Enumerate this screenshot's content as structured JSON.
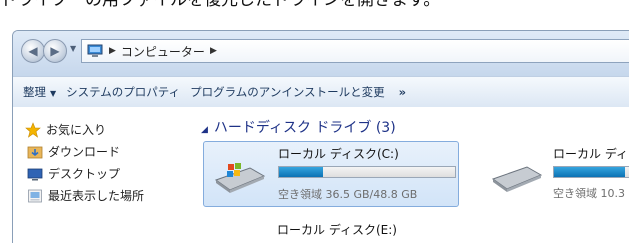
{
  "caption": "ドライブーの用ファイルを復元したドラインを開きます。",
  "titlebar": {
    "breadcrumb": [
      "コンピューター"
    ]
  },
  "toolbar": {
    "items": [
      "整理",
      "システムのプロパティ",
      "プログラムのアンインストールと変更"
    ],
    "more": "»"
  },
  "navigation": {
    "items": [
      {
        "label": "お気に入り",
        "icon": "star-icon"
      },
      {
        "label": "ダウンロード",
        "icon": "download-folder-icon"
      },
      {
        "label": "デスクトップ",
        "icon": "desktop-icon"
      },
      {
        "label": "最近表示した場所",
        "icon": "recent-places-icon"
      }
    ]
  },
  "content": {
    "group_header": "ハードディスク ドライブ (3)",
    "drives": [
      {
        "name": "ローカル ディスク(C:)",
        "free": "空き領域 36.5 GB/48.8 GB",
        "used_fraction": 0.25,
        "selected": true
      },
      {
        "name": "ローカル ディス",
        "free": "空き領域 10.3",
        "used_fraction": 0.9,
        "selected": false
      },
      {
        "name": "ローカル ディスク(E:)",
        "free": "",
        "used_fraction": null,
        "selected": false
      }
    ]
  },
  "colors": {
    "selection": "#d2e4f8",
    "bar_fill": "#1a86c9",
    "link_blue": "#1e3287"
  }
}
